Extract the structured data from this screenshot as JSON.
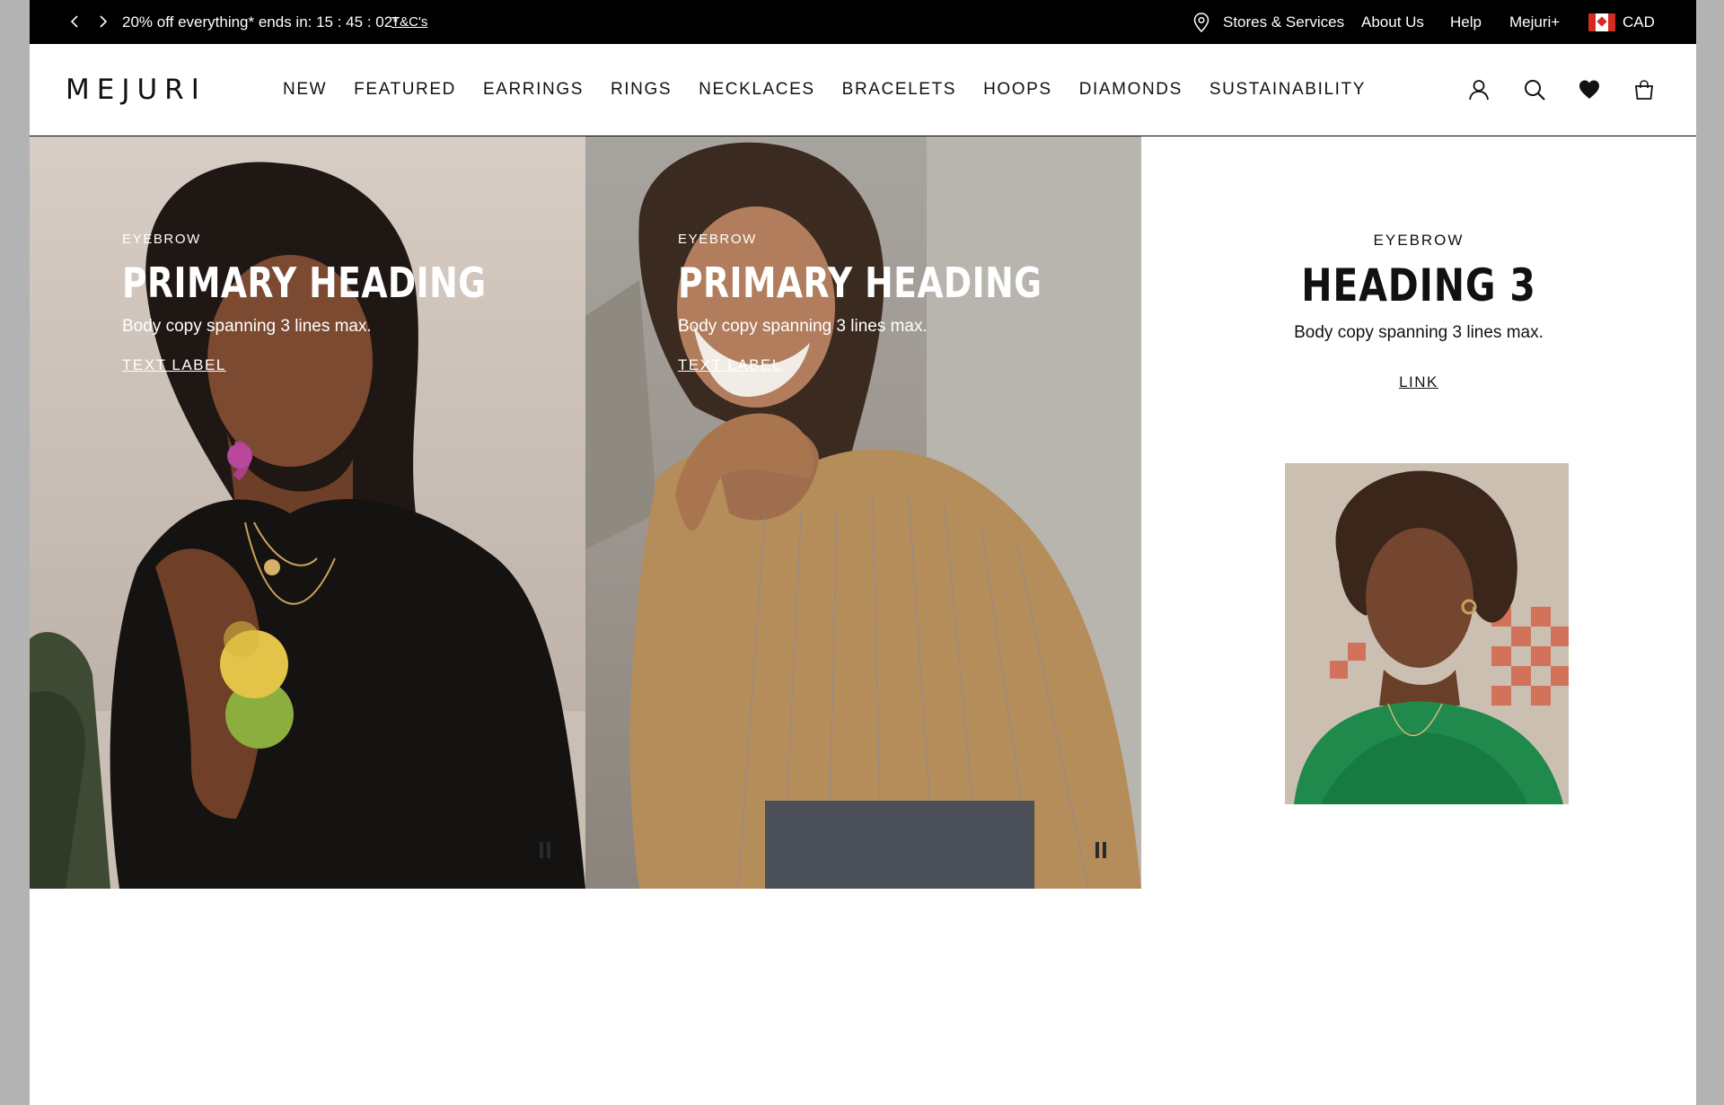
{
  "promo": {
    "message": "20% off everything* ends in: 15 : 45 : 02*",
    "terms_link": "T&C's"
  },
  "utility_nav": {
    "stores": "Stores & Services",
    "about": "About Us",
    "help": "Help",
    "plus": "Mejuri+",
    "currency": "CAD"
  },
  "header": {
    "logo": "MEJURI",
    "nav": [
      "NEW",
      "FEATURED",
      "EARRINGS",
      "RINGS",
      "NECKLACES",
      "BRACELETS",
      "HOOPS",
      "DIAMONDS",
      "SUSTAINABILITY"
    ]
  },
  "hero": [
    {
      "eyebrow": "EYEBROW",
      "heading": "PRIMARY HEADING",
      "body": "Body copy spanning 3 lines max.",
      "cta": "TEXT LABEL"
    },
    {
      "eyebrow": "EYEBROW",
      "heading": "PRIMARY HEADING",
      "body": "Body copy spanning 3 lines max.",
      "cta": "TEXT LABEL"
    }
  ],
  "feature": {
    "eyebrow": "EYEBROW",
    "heading": "HEADING 3",
    "body": "Body copy spanning 3 lines max.",
    "link": "LINK"
  }
}
